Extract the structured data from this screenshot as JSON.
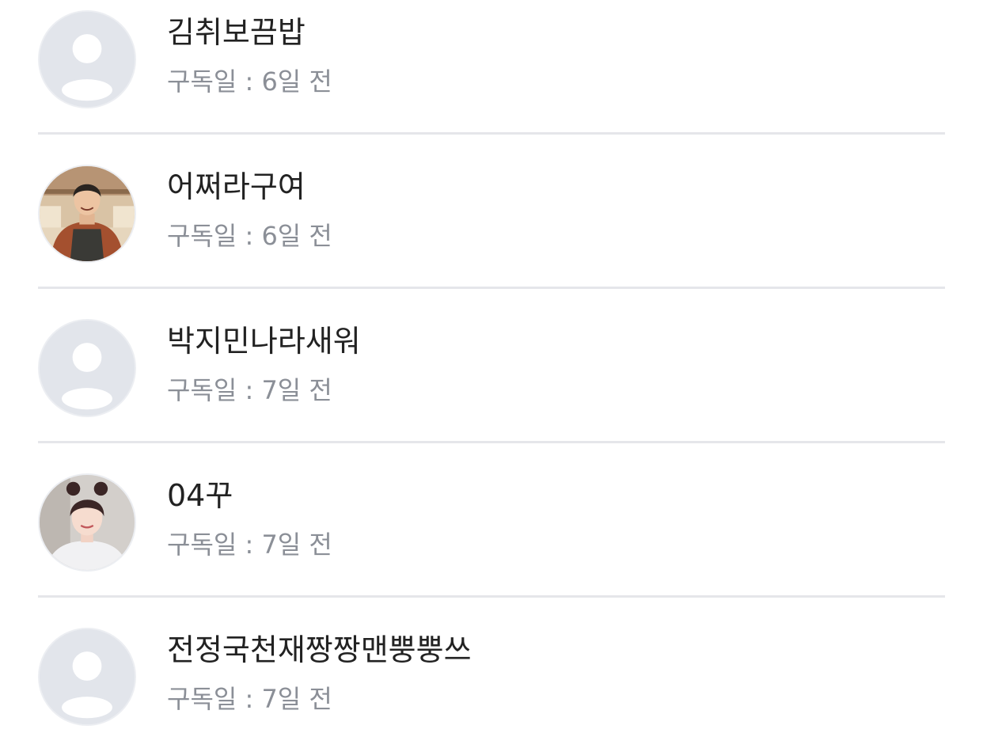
{
  "subscribers": [
    {
      "name": "김취보끔밥",
      "date_label": "구독일 : 6일 전",
      "avatar": "default-avatar-icon"
    },
    {
      "name": "어쩌라구여",
      "date_label": "구독일 : 6일 전",
      "avatar": "photo-avatar-man-apron"
    },
    {
      "name": "박지민나라새워",
      "date_label": "구독일 : 7일 전",
      "avatar": "default-avatar-icon"
    },
    {
      "name": "04꾸",
      "date_label": "구독일 : 7일 전",
      "avatar": "photo-avatar-woman-buns"
    },
    {
      "name": "전정국천재짱짱맨뿡뿡쓰",
      "date_label": "구독일 : 7일 전",
      "avatar": "default-avatar-icon"
    }
  ],
  "colors": {
    "avatar_bg": "#e2e5eb",
    "avatar_silhouette": "#ffffff",
    "divider": "#e5e6ea",
    "name_text": "#222222",
    "date_text": "#8b8f97"
  }
}
